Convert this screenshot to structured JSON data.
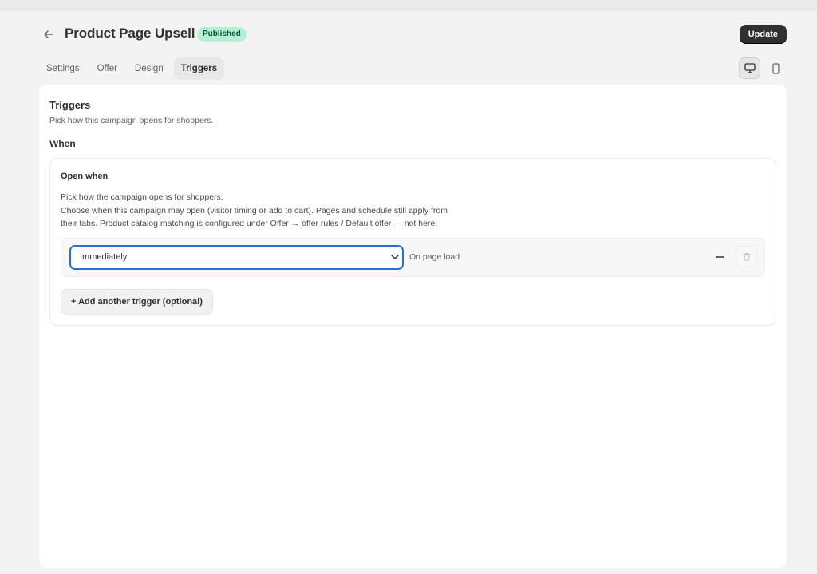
{
  "header": {
    "back_icon": "arrow-left-icon",
    "title": "Product Page Upsell",
    "status_badge": "Published",
    "update_label": "Update"
  },
  "tabs": [
    {
      "label": "Settings",
      "active": false
    },
    {
      "label": "Offer",
      "active": false
    },
    {
      "label": "Design",
      "active": false
    },
    {
      "label": "Triggers",
      "active": true
    }
  ],
  "device_toggle": {
    "selected": "desktop",
    "icons": [
      "desktop-icon",
      "mobile-icon"
    ]
  },
  "triggers_section": {
    "title": "Triggers",
    "subtitle": "Pick how this campaign opens for shoppers.",
    "when_heading": "When",
    "open_when": {
      "title": "Open when",
      "description_lines": [
        "Pick how the campaign opens for shoppers.",
        "Choose when this campaign may open (visitor timing or add to cart). Pages and schedule still apply from",
        "their tabs. Product catalog matching is configured under Offer → offer rules / Default offer — not here."
      ],
      "trigger": {
        "selected_value": "Immediately",
        "hint": "On page load"
      },
      "add_trigger_label": "+ Add another trigger (optional)"
    }
  },
  "colors": {
    "accent_focus": "#2c6ecb",
    "badge_bg": "#b4f0d4",
    "badge_text": "#0c5132",
    "primary_button": "#303030"
  }
}
